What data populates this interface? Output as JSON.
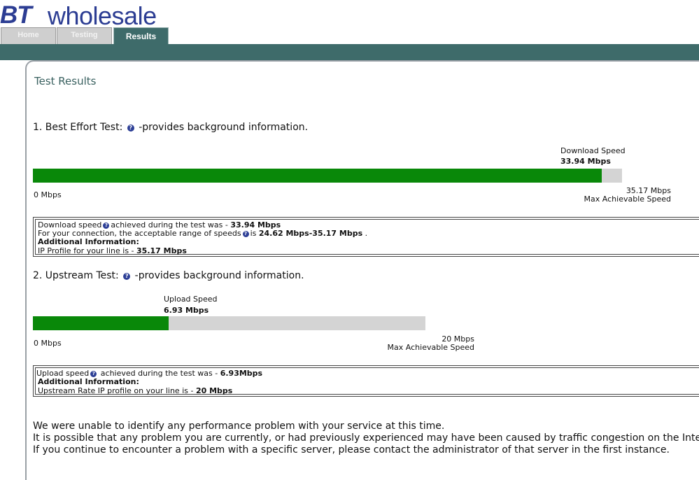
{
  "brand": {
    "bt": "BT",
    "wholesale": "wholesale"
  },
  "tabs": [
    {
      "label": "Home",
      "active": false
    },
    {
      "label": "Testing",
      "active": false
    },
    {
      "label": "Results",
      "active": true
    }
  ],
  "colors": {
    "accent": "#3e6b6a",
    "bar_fill": "#098809",
    "bar_track": "#d4d4d4",
    "brand": "#2c3d93"
  },
  "page_title": "Test Results",
  "best_effort": {
    "heading_prefix": "1. Best Effort Test:",
    "heading_suffix": "-provides background information.",
    "help_icon": "question-mark-icon",
    "speed_label": "Download Speed",
    "speed_value": "33.94 Mbps",
    "measured_mbps": 33.94,
    "max_mbps": 35.17,
    "min_label": "0 Mbps",
    "max_label": "35.17 Mbps",
    "max_caption": "Max Achievable Speed",
    "info": {
      "line1_prefix": "Download speed",
      "line1_mid": "achieved during the test was - ",
      "line1_value": "33.94 Mbps",
      "line2_prefix": "For your connection, the acceptable range of speeds",
      "line2_mid": "is ",
      "line2_value": "24.62 Mbps-35.17 Mbps",
      "line2_suffix": " .",
      "additional": "Additional Information:",
      "line4_prefix": "IP Profile for your line is - ",
      "line4_value": "35.17 Mbps"
    }
  },
  "upstream": {
    "heading_prefix": "2. Upstream Test:",
    "heading_suffix": "-provides background information.",
    "help_icon": "question-mark-icon",
    "speed_label": "Upload Speed",
    "speed_value": "6.93 Mbps",
    "measured_mbps": 6.93,
    "max_mbps": 20,
    "min_label": "0 Mbps",
    "max_label": "20 Mbps",
    "max_caption": "Max Achievable Speed",
    "info": {
      "line1_prefix": "Upload speed",
      "line1_mid": " achieved during the test was - ",
      "line1_value": "6.93Mbps",
      "additional": "Additional Information:",
      "line3_prefix": "Upstream Rate IP profile on your line is - ",
      "line3_value": "20 Mbps"
    }
  },
  "messages": [
    "We were unable to identify any performance problem with your service at this time.",
    "It is possible that any problem you are currently, or had previously experienced may have been caused by traffic congestion on the Internet",
    "If you continue to encounter a problem with a specific server, please contact the administrator of that server in the first instance."
  ]
}
